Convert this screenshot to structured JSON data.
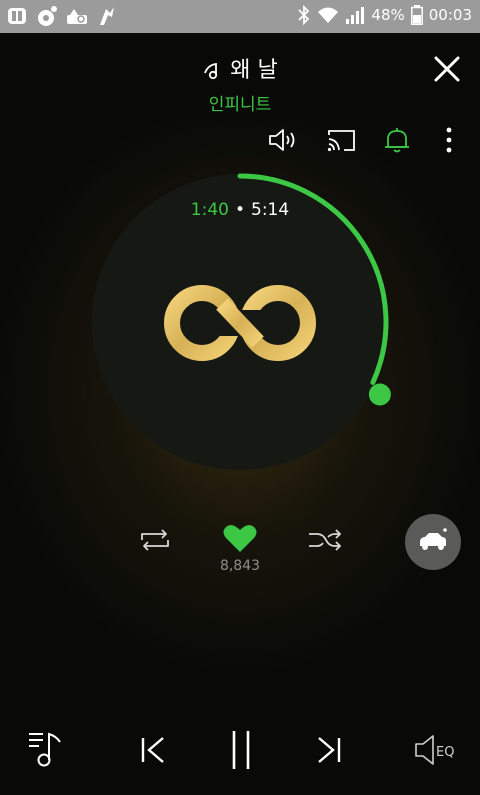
{
  "statusbar": {
    "battery": "48%",
    "time": "00:03"
  },
  "header": {
    "song_title": "왜 날",
    "artist": "인피니트"
  },
  "player": {
    "current_time": "1:40",
    "separator": "•",
    "total_time": "5:14",
    "progress": 0.318
  },
  "actions": {
    "like_count": "8,843"
  },
  "colors": {
    "accent": "#3cc845",
    "logo_gold": "#e2c062",
    "background": "#090a08"
  }
}
